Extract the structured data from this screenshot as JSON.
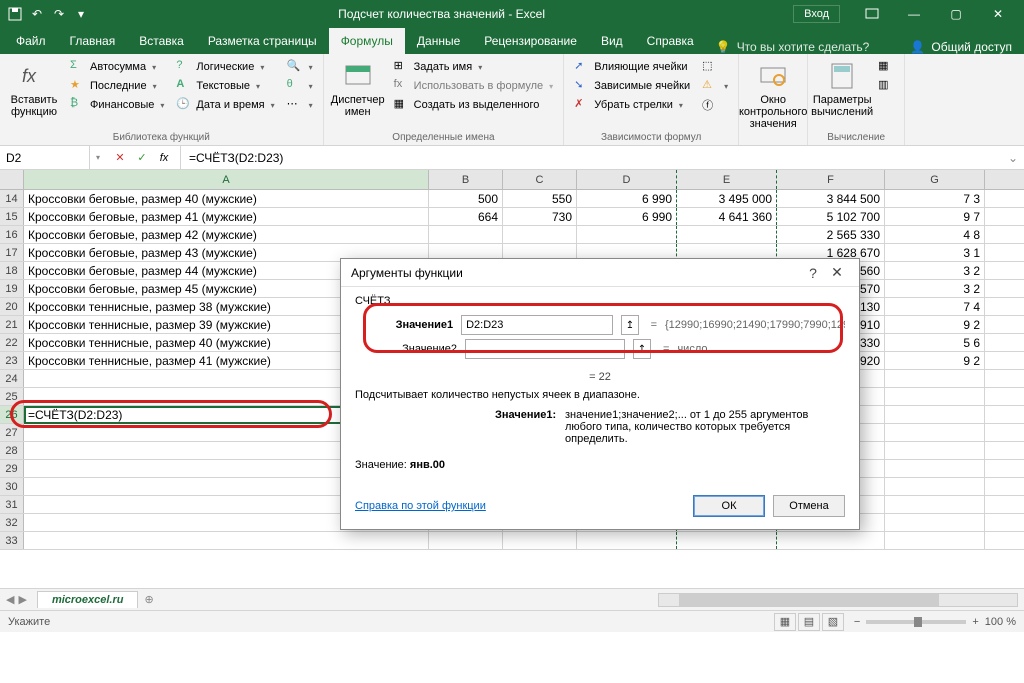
{
  "app": {
    "title": "Подсчет количества значений - Excel",
    "login": "Вход"
  },
  "tabs": {
    "file": "Файл",
    "home": "Главная",
    "insert": "Вставка",
    "page_layout": "Разметка страницы",
    "formulas": "Формулы",
    "data": "Данные",
    "review": "Рецензирование",
    "view": "Вид",
    "help": "Справка",
    "tell_me": "Что вы хотите сделать?",
    "share": "Общий доступ"
  },
  "ribbon": {
    "insert_fn": "Вставить функцию",
    "lib": {
      "autosum": "Автосумма",
      "recent": "Последние",
      "financial": "Финансовые",
      "logical": "Логические",
      "text": "Текстовые",
      "datetime": "Дата и время",
      "group": "Библиотека функций"
    },
    "name_mgr": "Диспетчер имен",
    "defnames": {
      "assign": "Задать имя",
      "use": "Использовать в формуле",
      "create": "Создать из выделенного",
      "group": "Определенные имена"
    },
    "audit": {
      "trace_prec": "Влияющие ячейки",
      "trace_dep": "Зависимые ячейки",
      "remove": "Убрать стрелки",
      "group": "Зависимости формул"
    },
    "watch": "Окно контрольного значения",
    "calc": {
      "options": "Параметры вычислений",
      "group": "Вычисление"
    }
  },
  "formula_bar": {
    "name_box": "D2",
    "formula": "=СЧЁТЗ(D2:D23)"
  },
  "columns": [
    "A",
    "B",
    "C",
    "D",
    "E",
    "F",
    "G"
  ],
  "rows": [
    {
      "n": 14,
      "A": "Кроссовки беговые, размер 40 (мужские)",
      "B": "500",
      "C": "550",
      "D": "6 990",
      "E": "3 495 000",
      "F": "3 844 500",
      "G": "7 3"
    },
    {
      "n": 15,
      "A": "Кроссовки беговые, размер 41 (мужские)",
      "B": "664",
      "C": "730",
      "D": "6 990",
      "E": "4 641 360",
      "F": "5 102 700",
      "G": "9 7"
    },
    {
      "n": 16,
      "A": "Кроссовки беговые, размер 42 (мужские)",
      "B": "",
      "C": "",
      "D": "",
      "E": "",
      "F": "2 565 330",
      "G": "4 8"
    },
    {
      "n": 17,
      "A": "Кроссовки беговые, размер 43 (мужские)",
      "B": "",
      "C": "",
      "D": "",
      "E": "",
      "F": "1 628 670",
      "G": "3 1"
    },
    {
      "n": 18,
      "A": "Кроссовки беговые, размер 44 (мужские)",
      "B": "",
      "C": "",
      "D": "",
      "E": "",
      "F": "1 705 560",
      "G": "3 2"
    },
    {
      "n": 19,
      "A": "Кроссовки беговые, размер 45 (мужские)",
      "B": "",
      "C": "",
      "D": "",
      "E": "",
      "F": "1 698 570",
      "G": "3 2"
    },
    {
      "n": 20,
      "A": "Кроссовки теннисные, размер 38 (мужские)",
      "B": "",
      "C": "",
      "D": "",
      "E": "",
      "F": "3 891 130",
      "G": "7 4"
    },
    {
      "n": 21,
      "A": "Кроссовки теннисные, размер 39 (мужские)",
      "B": "",
      "C": "",
      "D": "",
      "E": "",
      "F": "4 865 910",
      "G": "9 2"
    },
    {
      "n": 22,
      "A": "Кроссовки теннисные, размер 40 (мужские)",
      "B": "",
      "C": "",
      "D": "",
      "E": "",
      "F": "2 932 330",
      "G": "5 6"
    },
    {
      "n": 23,
      "A": "Кроссовки теннисные, размер 41 (мужские)",
      "B": "",
      "C": "",
      "D": "",
      "E": "",
      "F": "4 857 920",
      "G": "9 2"
    },
    {
      "n": 24,
      "A": "",
      "B": "",
      "C": "",
      "D": "",
      "E": "",
      "F": "",
      "G": ""
    },
    {
      "n": 25,
      "A": "",
      "B": "",
      "C": "",
      "D": "",
      "E": "",
      "F": "",
      "G": ""
    },
    {
      "n": 26,
      "A": "=СЧЁТЗ(D2:D23)",
      "B": "",
      "C": "",
      "D": "",
      "E": "",
      "F": "",
      "G": ""
    },
    {
      "n": 27,
      "A": "",
      "B": "",
      "C": "",
      "D": "",
      "E": "",
      "F": "",
      "G": ""
    },
    {
      "n": 28,
      "A": "",
      "B": "",
      "C": "",
      "D": "",
      "E": "",
      "F": "",
      "G": ""
    },
    {
      "n": 29,
      "A": "",
      "B": "",
      "C": "",
      "D": "",
      "E": "",
      "F": "",
      "G": ""
    },
    {
      "n": 30,
      "A": "",
      "B": "",
      "C": "",
      "D": "",
      "E": "",
      "F": "",
      "G": ""
    },
    {
      "n": 31,
      "A": "",
      "B": "",
      "C": "",
      "D": "",
      "E": "",
      "F": "",
      "G": ""
    },
    {
      "n": 32,
      "A": "",
      "B": "",
      "C": "",
      "D": "",
      "E": "",
      "F": "",
      "G": ""
    },
    {
      "n": 33,
      "A": "",
      "B": "",
      "C": "",
      "D": "",
      "E": "",
      "F": "",
      "G": ""
    }
  ],
  "dialog": {
    "title": "Аргументы функции",
    "func": "СЧЁТЗ",
    "arg1_label": "Значение1",
    "arg1_value": "D2:D23",
    "arg1_preview": "{12990;16990;21490;17990;7990;129...",
    "arg2_label": "Значение2",
    "arg2_preview": "число",
    "result_eq": "=  22",
    "desc": "Подсчитывает количество непустых ячеек в диапазоне.",
    "arg_desc_label": "Значение1:",
    "arg_desc_text": "значение1;значение2;... от 1 до 255 аргументов любого типа, количество которых требуется определить.",
    "value_label": "Значение:",
    "value_value": "янв.00",
    "help_link": "Справка по этой функции",
    "ok": "ОК",
    "cancel": "Отмена"
  },
  "sheet": {
    "name": "microexcel.ru"
  },
  "status": {
    "mode": "Укажите",
    "zoom": "100 %"
  }
}
